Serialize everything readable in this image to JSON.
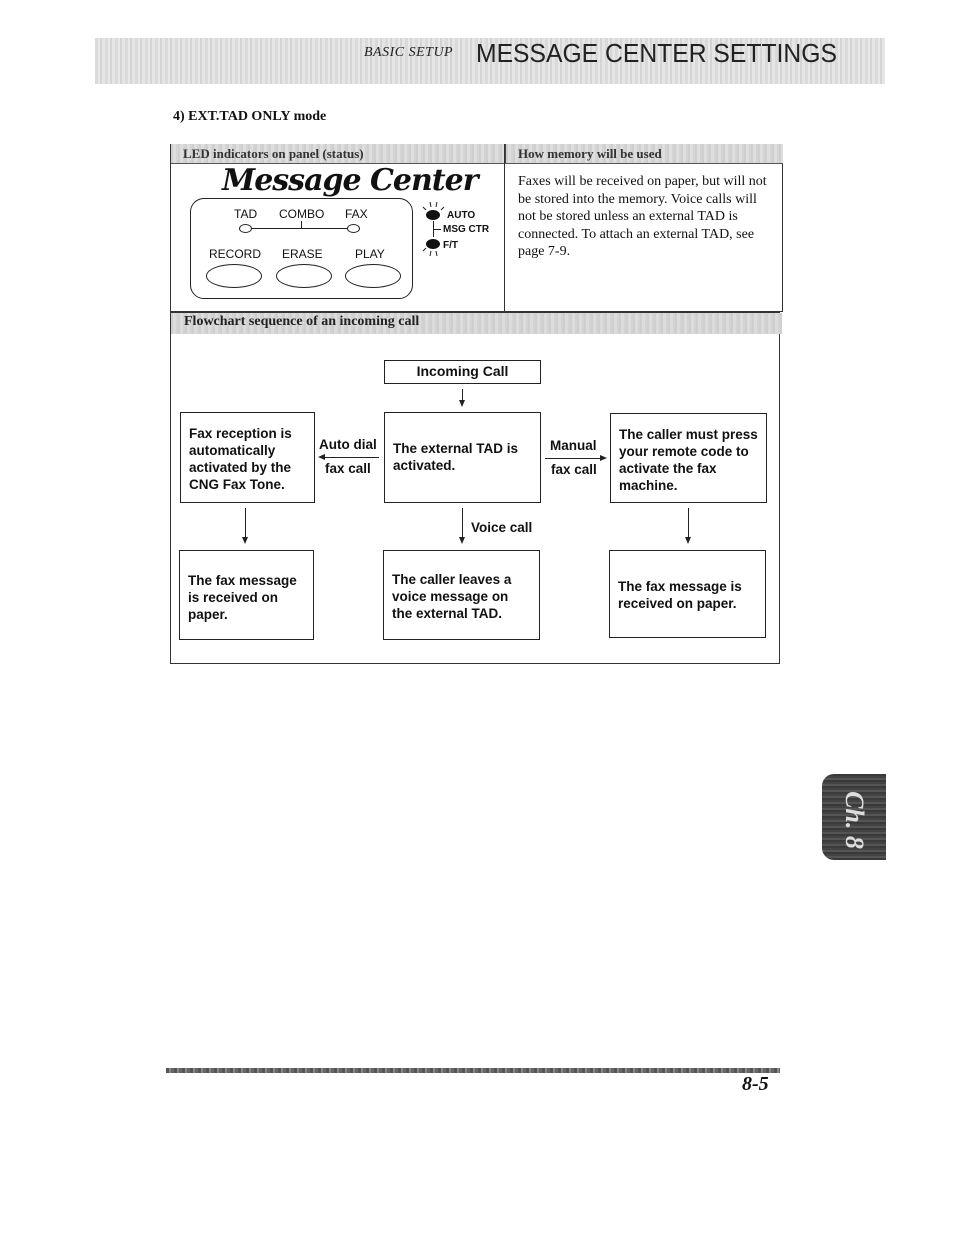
{
  "header": {
    "section": "BASIC SETUP",
    "title": "MESSAGE CENTER SETTINGS"
  },
  "mode_title": "4) EXT.TAD ONLY mode",
  "table": {
    "col_left_header": "LED indicators on panel (status)",
    "col_right_header": "How memory will be used",
    "memory_text": "Faxes will be received on paper, but will not be stored into the memory. Voice calls will not be stored unless an external TAD is connected. To attach an external TAD, see page 7-9.",
    "panel": {
      "logo": "Message Center",
      "mode_labels": [
        "TAD",
        "COMBO",
        "FAX"
      ],
      "button_labels": [
        "RECORD",
        "ERASE",
        "PLAY"
      ],
      "led_labels": {
        "auto": "AUTO",
        "msg_ctr": "MSG CTR",
        "ft": "F/T"
      }
    }
  },
  "flowchart": {
    "title": "Flowchart sequence of an incoming call",
    "start": "Incoming Call",
    "left_box": "Fax reception is automatically activated by the CNG Fax Tone.",
    "center_box": "The external TAD is activated.",
    "right_box": "The caller must press your remote code to activate the fax machine.",
    "left_arrow_label_1": "Auto dial",
    "left_arrow_label_2": "fax call",
    "right_arrow_label_1": "Manual",
    "right_arrow_label_2": "fax call",
    "center_down_label": "Voice call",
    "bottom_left": "The fax message is received on paper.",
    "bottom_center": "The caller leaves a voice message on the external TAD.",
    "bottom_right": "The fax message is received on paper."
  },
  "chapter_tab": "Ch. 8",
  "page_number": "8-5"
}
